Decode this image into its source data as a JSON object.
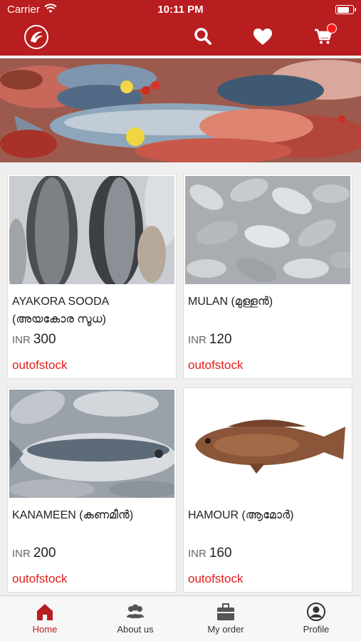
{
  "status_bar": {
    "carrier": "Carrier",
    "time": "10:11 PM",
    "battery_level": 0.8
  },
  "header": {
    "icons": [
      "logo-icon",
      "search-icon",
      "heart-icon",
      "cart-icon"
    ],
    "cart_has_badge": true
  },
  "colors": {
    "brand": "#b81d1f",
    "out_of_stock": "#e21d1d",
    "tab_inactive": "#333333"
  },
  "products": [
    {
      "name": "AYAKORA SOODA (അയകോര സൂധ)",
      "currency": "INR",
      "price": "300",
      "stock": "outofstock"
    },
    {
      "name": "MULAN (മുള്ളൻ)",
      "currency": "INR",
      "price": "120",
      "stock": "outofstock"
    },
    {
      "name": "KANAMEEN (കണമീൻ)",
      "currency": "INR",
      "price": "200",
      "stock": "outofstock"
    },
    {
      "name": "HAMOUR (ആമോർ)",
      "currency": "INR",
      "price": "160",
      "stock": "outofstock"
    }
  ],
  "tabs": [
    {
      "label": "Home",
      "icon": "home-icon",
      "active": true
    },
    {
      "label": "About us",
      "icon": "group-icon",
      "active": false
    },
    {
      "label": "My order",
      "icon": "briefcase-icon",
      "active": false
    },
    {
      "label": "Profile",
      "icon": "profile-icon",
      "active": false
    }
  ]
}
